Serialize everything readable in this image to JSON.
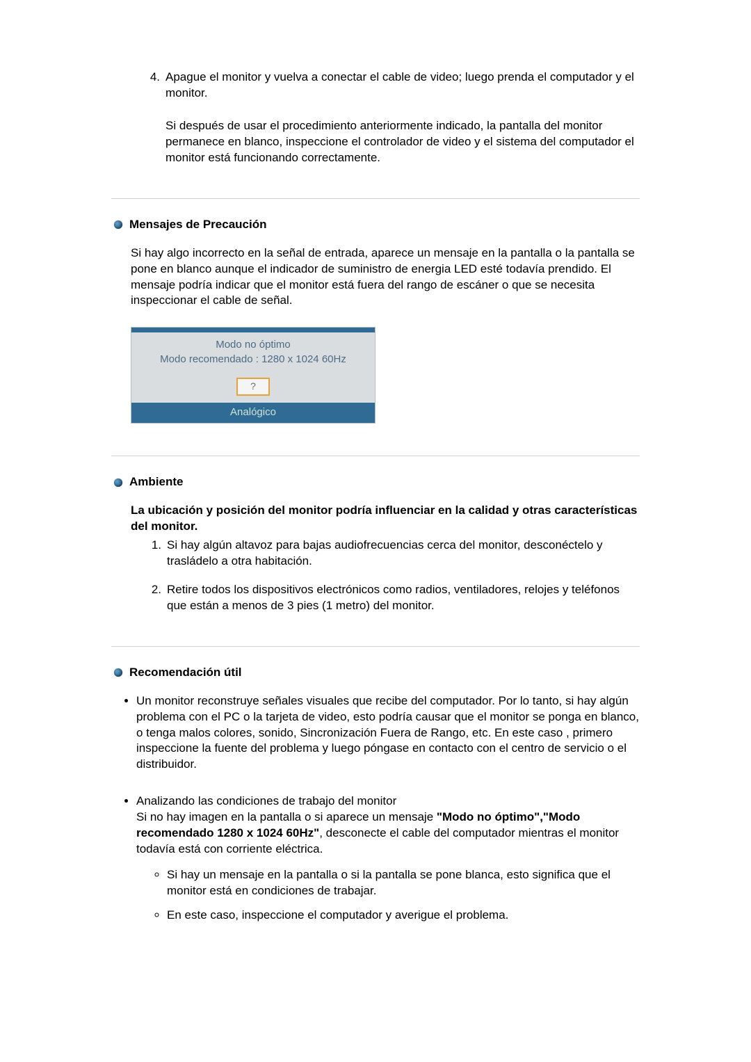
{
  "intro": {
    "step4_num": "4.",
    "step4_text": "Apague el monitor y vuelva a conectar el cable de video; luego prenda el computador y el monitor.",
    "step4_note": "Si después de usar el procedimiento anteriormente indicado, la pantalla del monitor permanece en blanco, inspeccione el controlador de video y el sistema del computador el monitor está funcionando correctamente."
  },
  "precaution": {
    "title": "Mensajes de Precaución",
    "body": "Si hay algo incorrecto en la señal de entrada, aparece un mensaje en la pantalla o la pantalla se pone en blanco aunque el indicador de suministro de energia LED esté todavía prendido. El mensaje podría indicar que el monitor está fuera del rango de escáner o que se necesita inspeccionar el cable de señal.",
    "box": {
      "line1": "Modo no óptimo",
      "line2": "Modo recomendado : 1280 x 1024  60Hz",
      "btn": "?",
      "bottom": "Analógico"
    }
  },
  "environment": {
    "title": "Ambiente",
    "lead": "La ubicación y posición del monitor podría influenciar en la calidad y otras características del monitor.",
    "item1_num": "1.",
    "item1": "Si hay algún altavoz para bajas audiofrecuencias cerca del monitor, desconéctelo y trasládelo a otra habitación.",
    "item2_num": "2.",
    "item2": "Retire todos los dispositivos electrónicos como radios, ventiladores, relojes y teléfonos que están a menos de 3 pies (1 metro) del monitor."
  },
  "recommendation": {
    "title": "Recomendación útil",
    "bullet1": "Un monitor reconstruye señales visuales que recibe del computador. Por lo tanto, si hay algún problema con el PC o la tarjeta de video, esto podría causar que el monitor se ponga en blanco, o tenga malos colores, sonido, Sincronización Fuera de Rango, etc. En este caso , primero inspeccione la fuente del problema y luego póngase en contacto con el centro de servicio o el distribuidor.",
    "bullet2_intro": "Analizando las condiciones de trabajo del monitor",
    "bullet2_pre": "Si no hay imagen en la pantalla o si aparece un mensaje ",
    "bullet2_bold": "\"Modo no óptimo\",\"Modo recomendado 1280 x 1024 60Hz\"",
    "bullet2_post": ", desconecte el cable del computador mientras el monitor todavía está con corriente eléctrica.",
    "sub1": "Si hay un mensaje en la pantalla o si la pantalla se pone blanca, esto significa que el monitor está en condiciones de trabajar.",
    "sub2": "En este caso, inspeccione el computador y averigue el problema."
  }
}
